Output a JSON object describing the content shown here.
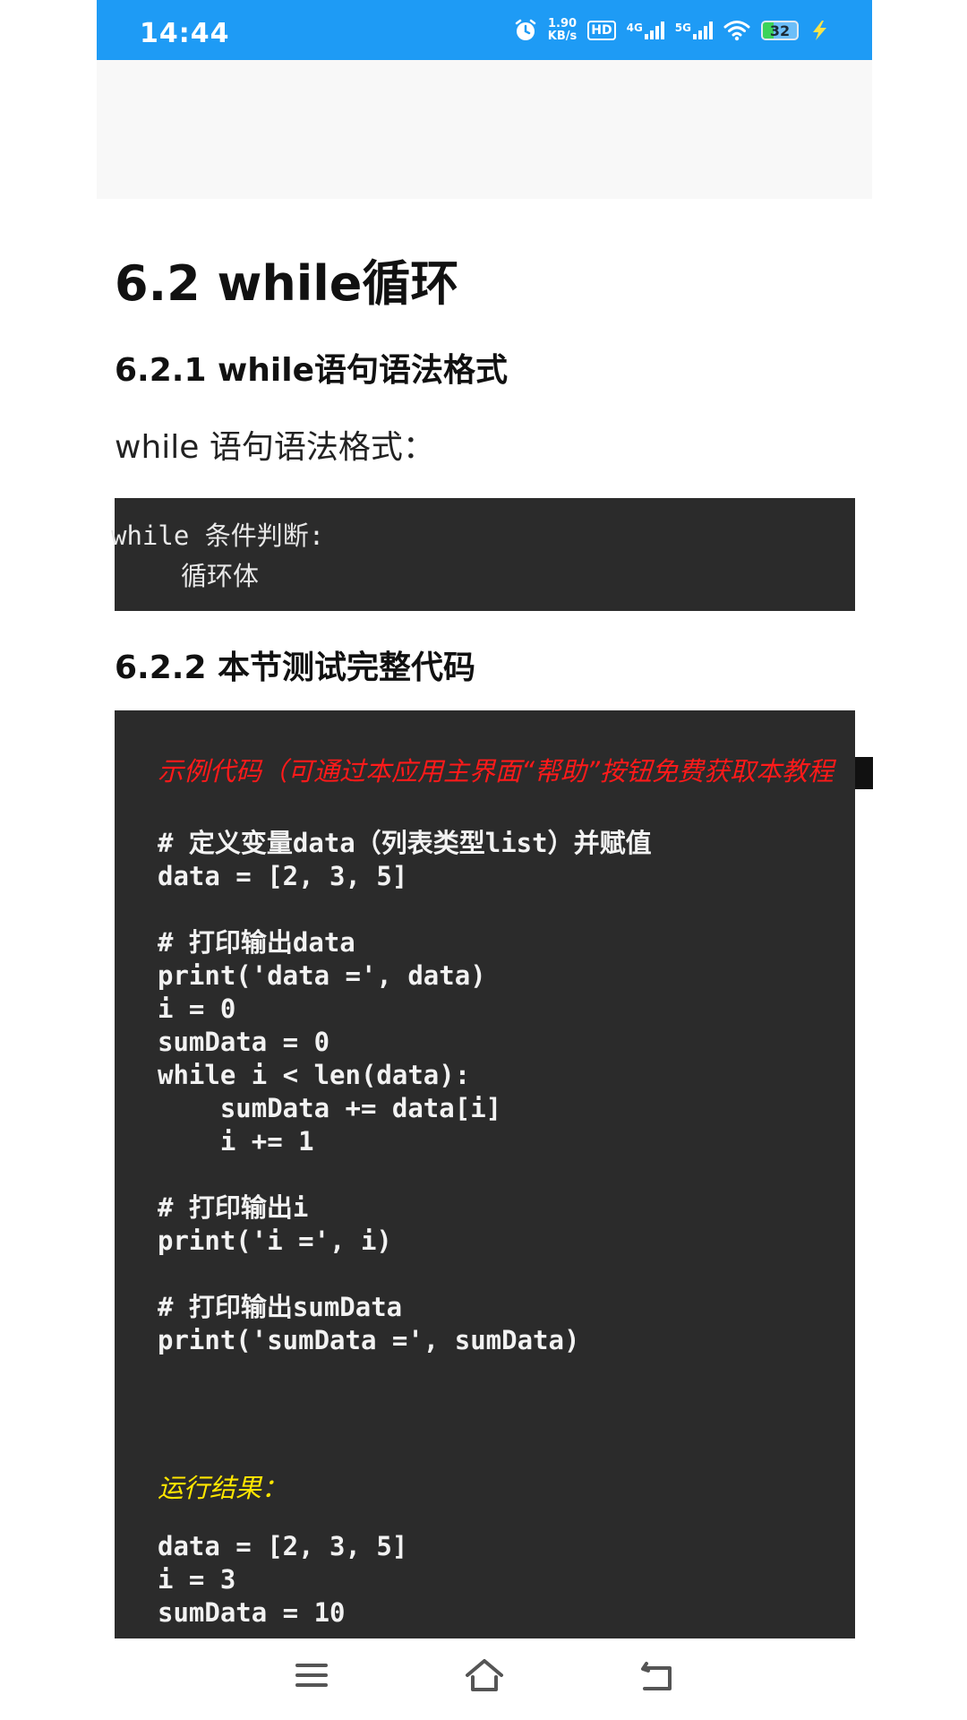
{
  "status_bar": {
    "time": "14:44",
    "net_speed_value": "1.90",
    "net_speed_unit": "KB/s",
    "hd_label": "HD",
    "sim1_label": "4G",
    "sim2_label": "5G",
    "battery_level": "32",
    "colors": {
      "background": "#1e9bf5"
    }
  },
  "article": {
    "title": "6.2 while循环",
    "section1_heading": "6.2.1 while语句语法格式",
    "section1_text": "while 语句语法格式：",
    "syntax_code": [
      "while 条件判断:",
      "循环体"
    ],
    "section2_heading": "6.2.2 本节测试完整代码",
    "code_note": "示例代码（可通过本应用主界面“帮助”按钮免费获取本教程",
    "code_lines": [
      "# 定义变量data（列表类型list）并赋值",
      "data = [2, 3, 5]",
      "",
      "# 打印输出data",
      "print('data =', data)",
      "i = 0",
      "sumData = 0",
      "while i < len(data):",
      "    sumData += data[i]",
      "    i += 1",
      "",
      "# 打印输出i",
      "print('i =', i)",
      "",
      "# 打印输出sumData",
      "print('sumData =', sumData)"
    ],
    "result_label": "运行结果：",
    "result_lines": [
      "data = [2, 3, 5]",
      "i = 3",
      "sumData = 10"
    ]
  },
  "nav": {
    "menu_icon": "menu-icon",
    "home_icon": "home-icon",
    "back_icon": "back-icon"
  }
}
